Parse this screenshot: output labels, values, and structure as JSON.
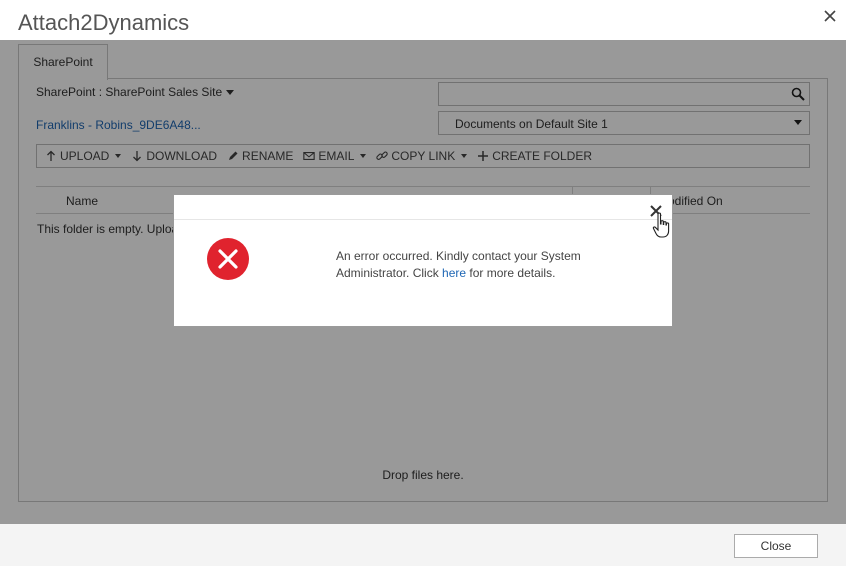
{
  "app": {
    "title": "Attach2Dynamics"
  },
  "tabs": [
    {
      "label": "SharePoint"
    }
  ],
  "site_selector": {
    "label": "SharePoint : SharePoint Sales Site"
  },
  "folder": {
    "path_label": "Franklins - Robins_9DE6A48..."
  },
  "search": {
    "placeholder": ""
  },
  "library_select": {
    "value": "Documents on Default Site 1"
  },
  "toolbar": {
    "upload": "UPLOAD",
    "download": "DOWNLOAD",
    "rename": "RENAME",
    "email": "EMAIL",
    "copy_link": "COPY LINK",
    "create_folder": "CREATE FOLDER"
  },
  "table": {
    "col_name": "Name",
    "col_modified": "Modified On",
    "empty_message": "This folder is empty. Upload"
  },
  "drop_zone": {
    "label": "Drop files here."
  },
  "footer": {
    "close_label": "Close"
  },
  "error_dialog": {
    "line1": "An error occurred. Kindly contact your System",
    "line2_pre": "Administrator. Click ",
    "link": "here",
    "line2_post": " for more details."
  },
  "colors": {
    "error_red": "#e0232e",
    "link_blue": "#1e66b4"
  },
  "icons": [
    "close-icon",
    "search-icon",
    "chevron-down-icon",
    "upload-icon",
    "download-icon",
    "pencil-icon",
    "mail-icon",
    "link-icon",
    "plus-icon",
    "error-icon",
    "hand-cursor-icon"
  ]
}
